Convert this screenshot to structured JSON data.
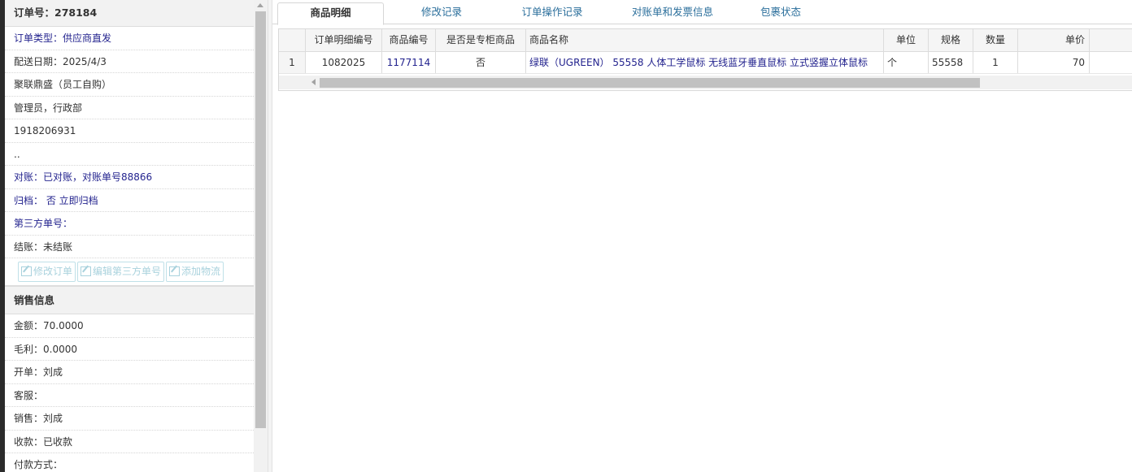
{
  "order": {
    "title": "订单号：278184",
    "fields": [
      {
        "text": "订单类型：供应商直发",
        "style": "blue"
      },
      {
        "text": "配送日期：2025/4/3",
        "style": "dark"
      },
      {
        "text": "聚联鼎盛（员工自购）",
        "style": "dark"
      },
      {
        "text": "管理员，行政部",
        "style": "dark"
      },
      {
        "text": "1918206931",
        "style": "dark"
      },
      {
        "text": "..",
        "style": "dark"
      },
      {
        "text": "对账：已对账，对账单号88866",
        "style": "blue"
      },
      {
        "text": "归档：  否 立即归档",
        "style": "blue"
      },
      {
        "text": "第三方单号：",
        "style": "blue"
      },
      {
        "text": "结账：未结账",
        "style": "dark"
      }
    ],
    "buttons": [
      "修改订单",
      "编辑第三方单号",
      "添加物流"
    ]
  },
  "sales": {
    "title": "销售信息",
    "fields": [
      {
        "text": "金额：70.0000"
      },
      {
        "text": "毛利：0.0000"
      },
      {
        "text": "开单：刘成"
      },
      {
        "text": "客服："
      },
      {
        "text": "销售：刘成"
      },
      {
        "text": "收款：已收款"
      },
      {
        "text": "付款方式："
      }
    ]
  },
  "tabs": [
    {
      "label": "商品明细",
      "active": true
    },
    {
      "label": "修改记录",
      "active": false
    },
    {
      "label": "订单操作记录",
      "active": false
    },
    {
      "label": "对账单和发票信息",
      "active": false
    },
    {
      "label": "包裹状态",
      "active": false
    }
  ],
  "table": {
    "columns": [
      "",
      "订单明细编号",
      "商品编号",
      "是否是专柜商品",
      "商品名称",
      "单位",
      "规格",
      "数量",
      "单价"
    ],
    "rows": [
      [
        "1",
        "1082025",
        "1177114",
        "否",
        "绿联（UGREEN） 55558 人体工学鼠标 无线蓝牙垂直鼠标 立式竖握立体鼠标",
        "个",
        "55558",
        "1",
        "70"
      ]
    ]
  },
  "colors": {
    "link": "#23238e",
    "tab_text": "#2a6e9b",
    "header_bg": "#f2f2f2"
  }
}
